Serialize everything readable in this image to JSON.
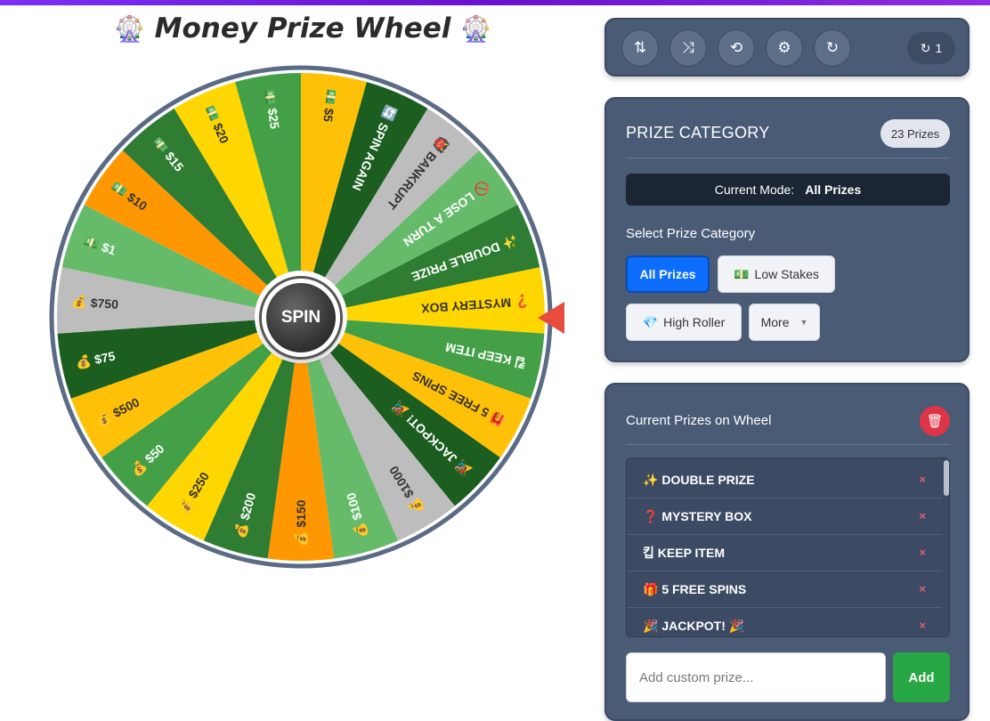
{
  "title": {
    "text": "Money Prize Wheel",
    "emoji_left": "🎡",
    "emoji_right": "🎡"
  },
  "wheel": {
    "spin_label": "SPIN",
    "segments": [
      {
        "label": "💵 $5",
        "color": "#FFC107"
      },
      {
        "label": "🔄 SPIN AGAIN",
        "color": "#1B5E20"
      },
      {
        "label": "👹 BANKRUPT",
        "color": "#BDBDBD"
      },
      {
        "label": "🚫 LOSE A TURN",
        "color": "#66BB6A"
      },
      {
        "label": "✨ DOUBLE PRIZE",
        "color": "#2E7D32"
      },
      {
        "label": "❓ MYSTERY BOX",
        "color": "#FFD600"
      },
      {
        "label": "킵 KEEP ITEM",
        "color": "#43A047"
      },
      {
        "label": "🎁 5 FREE SPINS",
        "color": "#FFC107"
      },
      {
        "label": "🎉 JACKPOT! 🎉",
        "color": "#1B5E20"
      },
      {
        "label": "💰 $1000",
        "color": "#BDBDBD"
      },
      {
        "label": "💰 $100",
        "color": "#66BB6A"
      },
      {
        "label": "💰 $150",
        "color": "#FF9800"
      },
      {
        "label": "💰 $200",
        "color": "#2E7D32"
      },
      {
        "label": "💰 $250",
        "color": "#FFD600"
      },
      {
        "label": "💰 $50",
        "color": "#43A047"
      },
      {
        "label": "💰 $500",
        "color": "#FFC107"
      },
      {
        "label": "💰 $75",
        "color": "#1B5E20"
      },
      {
        "label": "💰 $750",
        "color": "#BDBDBD"
      },
      {
        "label": "💵 $1",
        "color": "#66BB6A"
      },
      {
        "label": "💵 $10",
        "color": "#FF9800"
      },
      {
        "label": "💵 $15",
        "color": "#2E7D32"
      },
      {
        "label": "💵 $20",
        "color": "#FFD600"
      },
      {
        "label": "💵 $25",
        "color": "#43A047"
      }
    ],
    "pointer_color": "#E74C3C",
    "rim_color": "#5B6B85"
  },
  "toolbar": {
    "buttons": [
      {
        "name": "sort-icon",
        "glyph": "⇅"
      },
      {
        "name": "shuffle-icon",
        "glyph": "⤨"
      },
      {
        "name": "history-icon",
        "glyph": "⟲"
      },
      {
        "name": "gear-icon",
        "glyph": "⚙"
      },
      {
        "name": "redo-icon",
        "glyph": "↻"
      }
    ],
    "counter_icon": "↻",
    "counter_value": "1"
  },
  "category": {
    "title": "PRIZE CATEGORY",
    "badge": "23 Prizes",
    "mode_label": "Current Mode:",
    "mode_value": "All Prizes",
    "select_label": "Select Prize Category",
    "buttons": [
      {
        "label": "All Prizes",
        "icon": ""
      },
      {
        "label": "Low Stakes",
        "icon": "💵"
      },
      {
        "label": "High Roller",
        "icon": "💎"
      },
      {
        "label": "More",
        "icon": ""
      }
    ]
  },
  "prizes": {
    "title": "Current Prizes on Wheel",
    "items": [
      {
        "icon": "✨",
        "label": "DOUBLE PRIZE"
      },
      {
        "icon": "❓",
        "label": "MYSTERY BOX"
      },
      {
        "icon": "킵",
        "label": "KEEP ITEM"
      },
      {
        "icon": "🎁",
        "label": "5 FREE SPINS"
      },
      {
        "icon": "🎉",
        "label": "JACKPOT! 🎉"
      }
    ],
    "remove_glyph": "×",
    "input_placeholder": "Add custom prize...",
    "add_label": "Add"
  },
  "colors": {
    "panel": "#4A5B75",
    "primary": "#0D6EFD",
    "success": "#28A745",
    "danger": "#DC3545"
  }
}
